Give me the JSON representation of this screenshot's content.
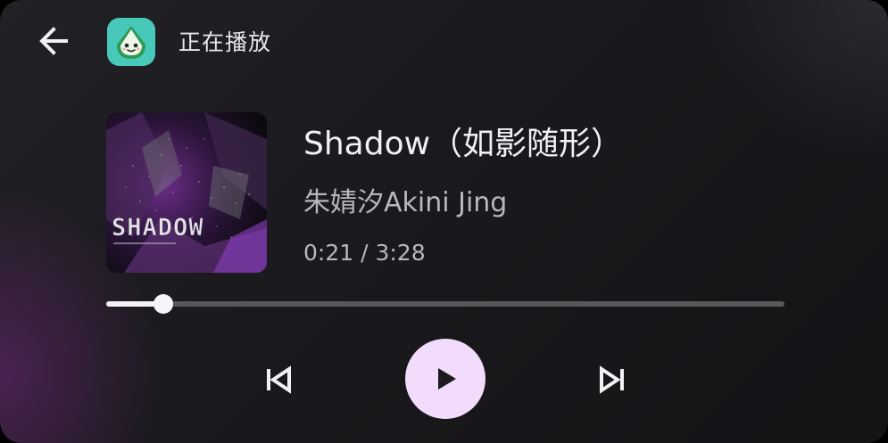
{
  "header": {
    "title": "正在播放"
  },
  "track": {
    "title": "Shadow（如影随形）",
    "artist": "朱婧汐Akini Jing",
    "time_display": "0:21 / 3:28",
    "album_art_text": "SHADOW",
    "position_seconds": 21,
    "duration_seconds": 208
  },
  "controls": {
    "previous": "skip-previous-icon",
    "play": "play-icon",
    "next": "skip-next-icon",
    "back": "arrow-back-icon"
  },
  "colors": {
    "accent": "#f2dcfb",
    "background": "#1a191d",
    "progress_fill": "#f4f2f6",
    "progress_track": "#59575c"
  }
}
